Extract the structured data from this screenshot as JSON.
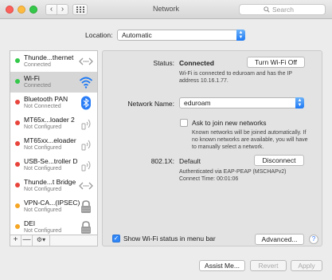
{
  "window": {
    "title": "Network"
  },
  "search": {
    "placeholder": "Search"
  },
  "location": {
    "label": "Location:",
    "value": "Automatic"
  },
  "services": [
    {
      "name": "Thunde...thernet",
      "status": "Connected",
      "color": "#34c84a",
      "icon": "ethernet-arrows-icon"
    },
    {
      "name": "Wi-Fi",
      "status": "Connected",
      "color": "#34c84a",
      "icon": "wifi-icon"
    },
    {
      "name": "Bluetooth PAN",
      "status": "Not Connected",
      "color": "#e8443b",
      "icon": "bluetooth-icon"
    },
    {
      "name": "MT65x...loader 2",
      "status": "Not Configured",
      "color": "#e8443b",
      "icon": "phone-signal-icon"
    },
    {
      "name": "MT65xx...eloader",
      "status": "Not Configured",
      "color": "#e8443b",
      "icon": "phone-signal-icon"
    },
    {
      "name": "USB-Se...troller D",
      "status": "Not Configured",
      "color": "#e8443b",
      "icon": "phone-signal-icon"
    },
    {
      "name": "Thunde...t Bridge",
      "status": "Not Configured",
      "color": "#e8443b",
      "icon": "ethernet-arrows-icon"
    },
    {
      "name": "VPN-CA...(IPSEC)",
      "status": "Not Configured",
      "color": "#f5a623",
      "icon": "lock-icon"
    },
    {
      "name": "DEI",
      "status": "Not Configured",
      "color": "#f5a623",
      "icon": "lock-icon"
    }
  ],
  "sidebar_footer": {
    "add": "+",
    "remove": "—",
    "action": "⚙▾"
  },
  "status": {
    "label": "Status:",
    "value": "Connected",
    "button": "Turn Wi-Fi Off",
    "description": "Wi-Fi is connected to eduroam and has the IP address 10.16.1.77."
  },
  "network_name": {
    "label": "Network Name:",
    "value": "eduroam"
  },
  "ask_join": {
    "label": "Ask to join new networks",
    "description": "Known networks will be joined automatically. If no known networks are available, you will have to manually select a network."
  },
  "dot1x": {
    "label": "802.1X:",
    "value": "Default",
    "button": "Disconnect",
    "line1": "Authenticated via EAP-PEAP (MSCHAPv2)",
    "line2": "Connect Time: 00:01:06"
  },
  "show_status": {
    "label": "Show Wi-Fi status in menu bar"
  },
  "advanced_button": "Advanced...",
  "help": "?",
  "bottom": {
    "assist": "Assist Me...",
    "revert": "Revert",
    "apply": "Apply"
  }
}
